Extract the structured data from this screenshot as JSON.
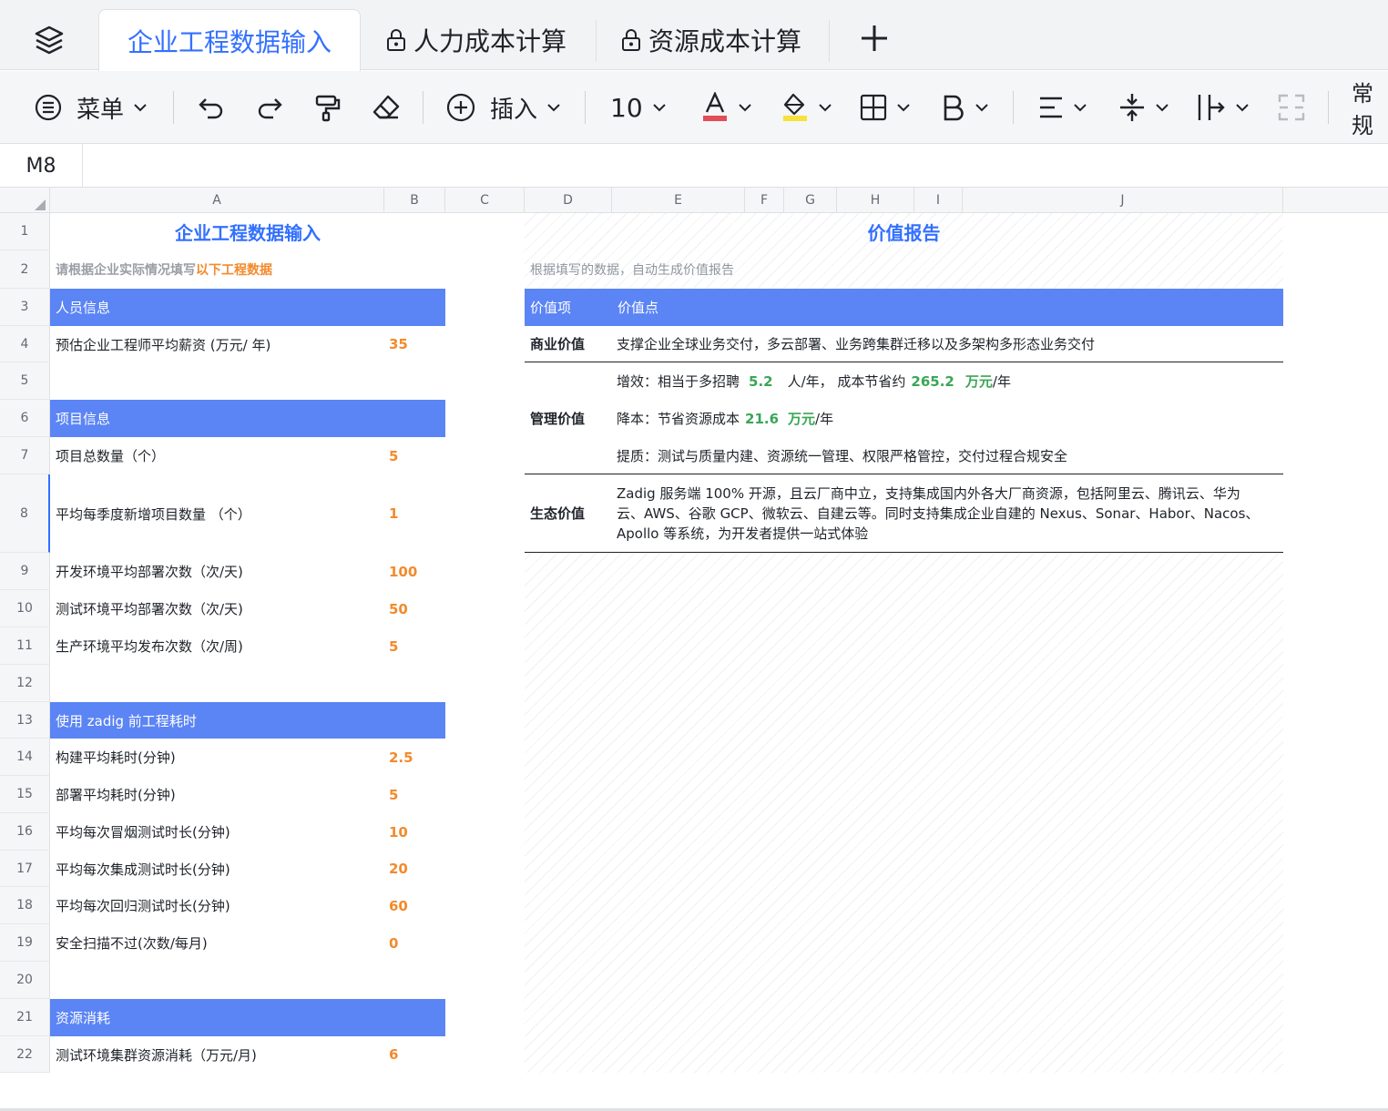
{
  "tabs": [
    {
      "label": "企业工程数据输入"
    },
    {
      "label": "人力成本计算"
    },
    {
      "label": "资源成本计算"
    }
  ],
  "toolbar": {
    "menu_label": "菜单",
    "insert_label": "插入",
    "font_size": "10",
    "format_label": "常规",
    "font_color": "#e34d59",
    "fill_color": "#f7e13c"
  },
  "formula": {
    "cell_ref": "M8"
  },
  "columns": [
    "A",
    "B",
    "C",
    "D",
    "E",
    "F",
    "G",
    "H",
    "I",
    "J"
  ],
  "rows": [
    "1",
    "2",
    "3",
    "4",
    "5",
    "6",
    "7",
    "8",
    "9",
    "10",
    "11",
    "12",
    "13",
    "14",
    "15",
    "16",
    "17",
    "18",
    "19",
    "20",
    "21",
    "22"
  ],
  "input": {
    "title": "企业工程数据输入",
    "hint_prefix": "请根据企业实际情况填写",
    "hint_highlight": "以下工程数据",
    "sections": {
      "people": "人员信息",
      "project": "项目信息",
      "before": "使用 zadig 前工程耗时",
      "resource": "资源消耗"
    },
    "items": {
      "salary": {
        "label": "预估企业工程师平均薪资 (万元/ 年)",
        "value": "35"
      },
      "project_count": {
        "label": "项目总数量（个）",
        "value": "5"
      },
      "new_projects": {
        "label": "平均每季度新增项目数量 （个）",
        "value": "1"
      },
      "dev_deploys": {
        "label": "开发环境平均部署次数（次/天)",
        "value": "100"
      },
      "test_deploys": {
        "label": "测试环境平均部署次数（次/天)",
        "value": "50"
      },
      "prod_releases": {
        "label": "生产环境平均发布次数（次/周)",
        "value": "5"
      },
      "build_time": {
        "label": "构建平均耗时(分钟)",
        "value": "2.5"
      },
      "deploy_time": {
        "label": "部署平均耗时(分钟)",
        "value": "5"
      },
      "smoke_time": {
        "label": "平均每次冒烟测试时长(分钟)",
        "value": "10"
      },
      "integration_time": {
        "label": "平均每次集成测试时长(分钟)",
        "value": "20"
      },
      "regression_time": {
        "label": "平均每次回归测试时长(分钟)",
        "value": "60"
      },
      "security_fail": {
        "label": "安全扫描不过(次数/每月)",
        "value": "0"
      },
      "test_cluster": {
        "label": "测试环境集群资源消耗（万元/月)",
        "value": "6"
      }
    }
  },
  "report": {
    "title": "价值报告",
    "hint": "根据填写的数据，自动生成价值报告",
    "col_item": "价值项",
    "col_point": "价值点",
    "business": {
      "key": "商业价值",
      "text": "支撑企业全球业务交付，多云部署、业务跨集群迁移以及多架构多形态业务交付"
    },
    "management": {
      "key": "管理价值",
      "line1_a": "增效：相当于多招聘",
      "line1_v1": "5.2",
      "line1_b": "人/年，  成本节省约",
      "line1_v2": "265.2",
      "line1_u": "万元",
      "line1_c": "/年",
      "line2_a": "降本：节省资源成本",
      "line2_v": "21.6",
      "line2_u": "万元",
      "line2_c": "/年",
      "line3": "提质：测试与质量内建、资源统一管理、权限严格管控，交付过程合规安全"
    },
    "ecosystem": {
      "key": "生态价值",
      "text": "Zadig 服务端 100% 开源，且云厂商中立，支持集成国内外各大厂商资源，包括阿里云、腾讯云、华为云、AWS、谷歌 GCP、微软云、自建云等。同时支持集成企业自建的 Nexus、Sonar、Habor、Nacos、Apollo 等系统，为开发者提供一站式体验"
    }
  }
}
